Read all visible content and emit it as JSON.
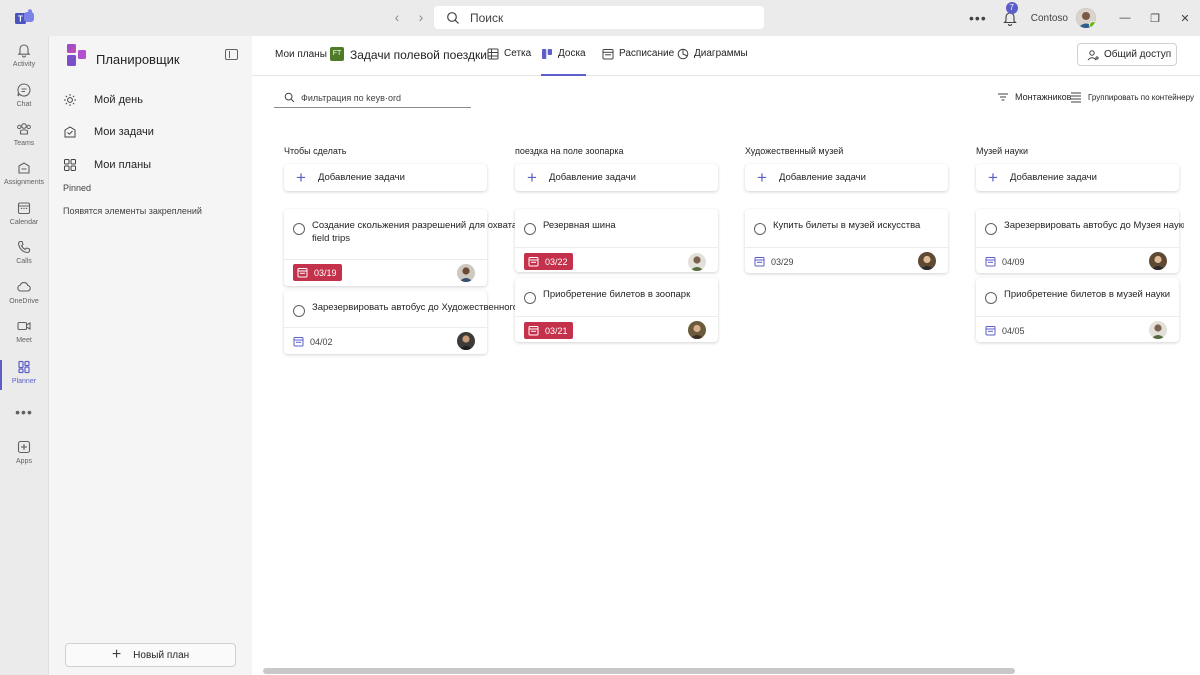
{
  "titlebar": {
    "search_placeholder": "Поиск",
    "notification_count": "7",
    "org_name": "Contoso"
  },
  "rail": {
    "items": [
      {
        "label": "Activity",
        "icon": "bell-icon"
      },
      {
        "label": "Chat",
        "icon": "chat-icon"
      },
      {
        "label": "Teams",
        "icon": "teams-icon"
      },
      {
        "label": "Assignments",
        "icon": "assignments-icon"
      },
      {
        "label": "Calendar",
        "icon": "calendar-icon"
      },
      {
        "label": "Calls",
        "icon": "phone-icon"
      },
      {
        "label": "OneDrive",
        "icon": "cloud-icon"
      },
      {
        "label": "Meet",
        "icon": "video-icon"
      },
      {
        "label": "Planner",
        "icon": "planner-icon",
        "active": true
      },
      {
        "label": "Apps",
        "icon": "apps-icon"
      }
    ],
    "more": "•••"
  },
  "sidebar": {
    "title": "Планировщик",
    "items": [
      {
        "label": "Мой день",
        "icon": "sun-icon"
      },
      {
        "label": "Мои задачи",
        "icon": "my-tasks-icon"
      },
      {
        "label": "Мои планы",
        "icon": "grid-icon"
      }
    ],
    "pinned_label": "Pinned",
    "pinned_empty": "Появятся элементы закреплений",
    "new_plan": "Новый план"
  },
  "header": {
    "breadcrumb": "Мои планы &",
    "plan_badge": "FT",
    "plan_name": "Задачи полевой поездки",
    "tabs": [
      {
        "label": "Сетка",
        "icon": "grid-view-icon"
      },
      {
        "label": "Доска",
        "icon": "board-icon",
        "active": true
      },
      {
        "label": "Расписание",
        "icon": "schedule-icon"
      },
      {
        "label": "Диаграммы",
        "icon": "charts-icon"
      }
    ],
    "share": "Общий доступ"
  },
  "toolbar": {
    "filter_placeholder": "Фильтрация по keyword",
    "filter_display": "Фильтрация по keyв·ord",
    "assignee": "Монтажников",
    "group_by": "Группировать по контейнеру"
  },
  "colors": {
    "accent": "#5b5fc7",
    "late": "#c4314b",
    "plan_badge": "#4f7a28"
  },
  "board": {
    "add_task_label": "Добавление задачи",
    "buckets": [
      {
        "name": "Чтобы сделать",
        "tasks": [
          {
            "title": "Создание скольжения разрешений для охвата всех field trips",
            "due": "03/19",
            "late": true
          },
          {
            "title": "Зарезервировать автобус до Художественного музея",
            "due": "04/02",
            "late": false
          }
        ]
      },
      {
        "name": "поездка на поле зоопарка",
        "tasks": [
          {
            "title": "Резервная шина",
            "due": "03/22",
            "late": true
          },
          {
            "title": "Приобретение билетов в зоопарк",
            "due": "03/21",
            "late": true
          }
        ]
      },
      {
        "name": "Художественный музей",
        "tasks": [
          {
            "title": "Купить билеты в музей искусства",
            "due": "03/29",
            "late": false
          }
        ]
      },
      {
        "name": "Музей науки",
        "tasks": [
          {
            "title": "Зарезервировать автобус до Музея науки",
            "due": "04/09",
            "late": false
          },
          {
            "title": "Приобретение билетов в музей науки",
            "due": "04/05",
            "late": false
          }
        ]
      }
    ]
  }
}
